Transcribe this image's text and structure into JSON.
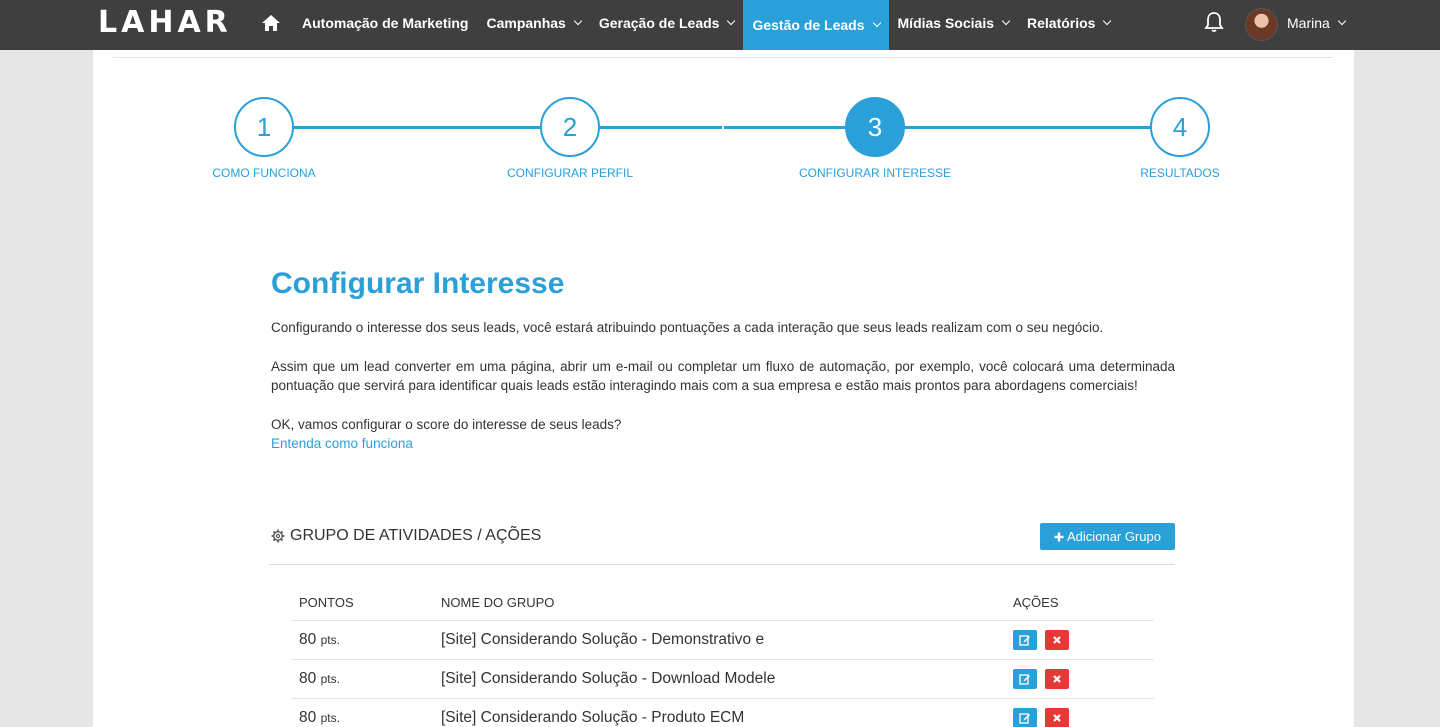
{
  "nav": {
    "logo": "LAHAR",
    "items": [
      {
        "label": "Automação de Marketing",
        "dropdown": false,
        "active": false
      },
      {
        "label": "Campanhas",
        "dropdown": true,
        "active": false
      },
      {
        "label": "Geração de Leads",
        "dropdown": true,
        "active": false
      },
      {
        "label": "Gestão de Leads",
        "dropdown": true,
        "active": true
      },
      {
        "label": "Mídias Sociais",
        "dropdown": true,
        "active": false
      },
      {
        "label": "Relatórios",
        "dropdown": true,
        "active": false
      }
    ],
    "user": "Marina"
  },
  "steps": [
    {
      "number": "1",
      "label": "COMO FUNCIONA"
    },
    {
      "number": "2",
      "label": "CONFIGURAR PERFIL"
    },
    {
      "number": "3",
      "label": "CONFIGURAR INTERESSE"
    },
    {
      "number": "4",
      "label": "RESULTADOS"
    }
  ],
  "page": {
    "title": "Configurar Interesse",
    "p1": "Configurando o interesse dos seus leads, você estará atribuindo pontuações a cada interação que seus leads realizam com o seu negócio.",
    "p2": "Assim que um lead converter em uma página, abrir um e-mail ou completar um fluxo de automação, por exemplo, você colocará uma determinada pontuação que servirá para identificar quais leads estão interagindo mais com a sua empresa e estão mais prontos para abordagens comerciais!",
    "p3": "OK, vamos configurar o score do interesse de seus leads?",
    "link": "Entenda como funciona"
  },
  "group": {
    "title": "GRUPO DE ATIVIDADES / AÇÕES",
    "add_label": "Adicionar Grupo"
  },
  "table": {
    "headers": [
      "PONTOS",
      "NOME DO GRUPO",
      "AÇÕES"
    ],
    "pts_suffix": "pts.",
    "rows": [
      {
        "points": "80",
        "name": "[Site] Considerando Solução - Demonstrativo e"
      },
      {
        "points": "80",
        "name": "[Site] Considerando Solução - Download Modele"
      },
      {
        "points": "80",
        "name": "[Site] Considerando Solução - Produto ECM"
      }
    ]
  }
}
